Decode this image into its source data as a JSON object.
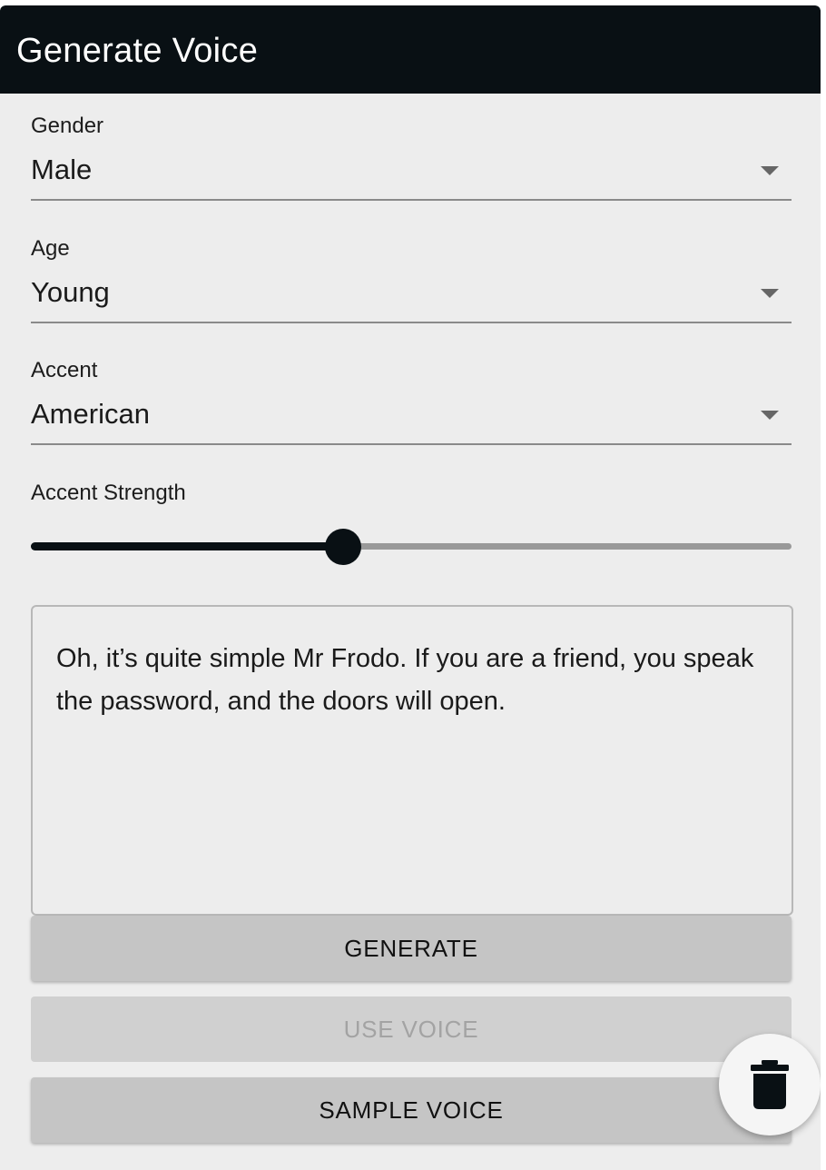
{
  "window": {
    "title": "Generate Voice"
  },
  "form": {
    "gender": {
      "label": "Gender",
      "value": "Male"
    },
    "age": {
      "label": "Age",
      "value": "Young"
    },
    "accent": {
      "label": "Accent",
      "value": "American"
    },
    "accent_strength": {
      "label": "Accent Strength",
      "value_fraction": 0.41
    },
    "text": "Oh, it’s quite simple Mr Frodo. If you are a friend, you speak the password, and the doors will open."
  },
  "buttons": {
    "generate": "GENERATE",
    "use_voice": "USE VOICE",
    "sample_voice": "SAMPLE VOICE"
  },
  "icons": {
    "fab": "trash-icon"
  },
  "colors": {
    "header_bg": "#091014",
    "panel_bg": "#ededed",
    "button_bg": "#c5c5c5",
    "accent": "#091014"
  }
}
